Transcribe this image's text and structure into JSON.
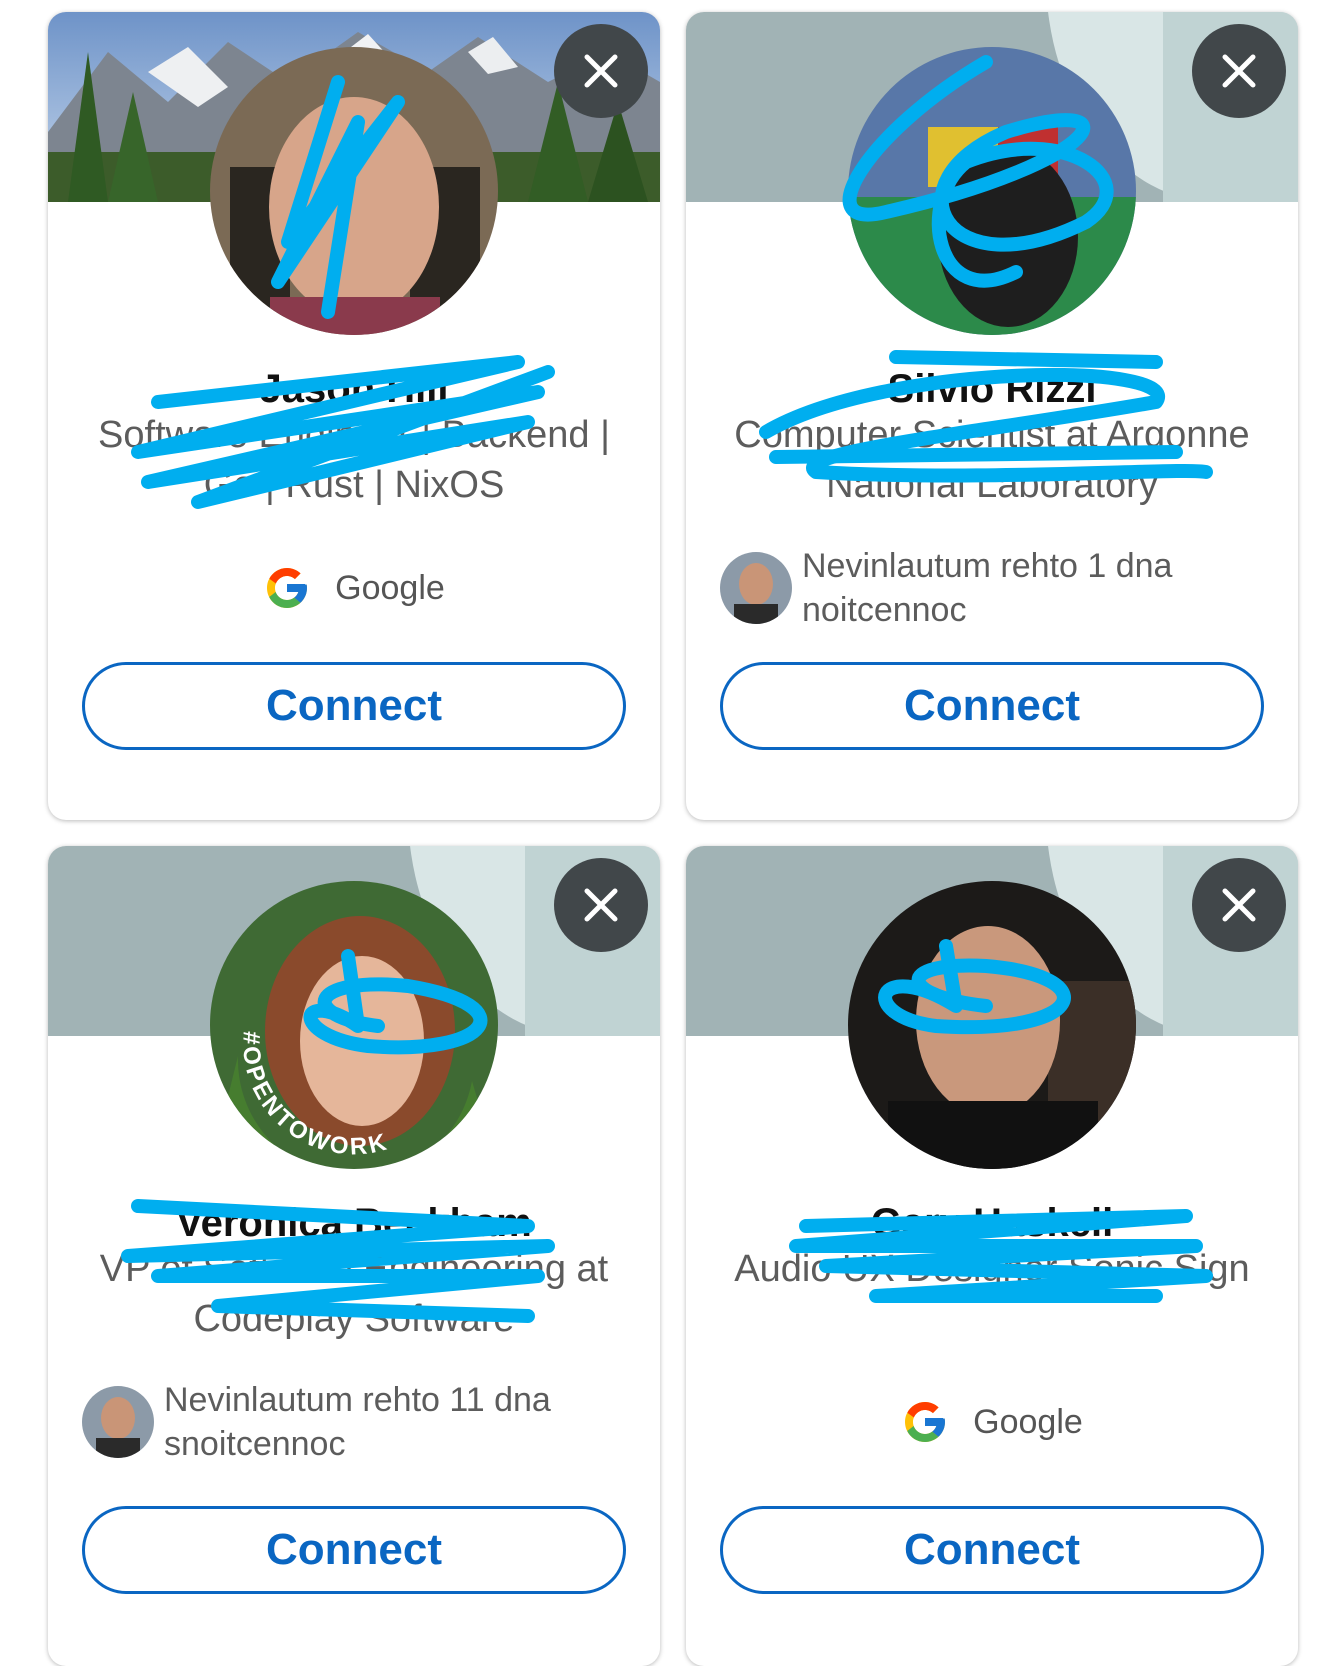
{
  "cards": [
    {
      "name": "Jason Hill",
      "headline": "Software Engineer | Backend | Go | Rust | NixOS",
      "insight_label": "Google",
      "connect_label": "Connect",
      "dismiss_icon": "close-icon"
    },
    {
      "name": "Silvio Rizzi",
      "headline": "Computer Scientist at Argonne National Laboratory",
      "mutual_text": "Nevinlautum rehto 1 dna noitcennoc",
      "connect_label": "Connect",
      "dismiss_icon": "close-icon"
    },
    {
      "name": "Veronica Beckham",
      "headline": "VP of Software Engineering at Codeplay Software",
      "mutual_text": "Nevinlautum rehto 11 dna snoitcennoc",
      "badge_text": "#OPENTOWORK",
      "connect_label": "Connect",
      "dismiss_icon": "close-icon"
    },
    {
      "name": "Gary Haskell",
      "headline": "Audio UX Designer Sonic Sign",
      "insight_label": "Google",
      "connect_label": "Connect",
      "dismiss_icon": "close-icon"
    }
  ],
  "colors": {
    "connect_blue": "#0a66c2",
    "dismiss_bg": "#41474a",
    "banner_gray": "#a1b3b5",
    "scribble_blue": "#00aeef",
    "open_to_work_green": "#467d2f"
  }
}
